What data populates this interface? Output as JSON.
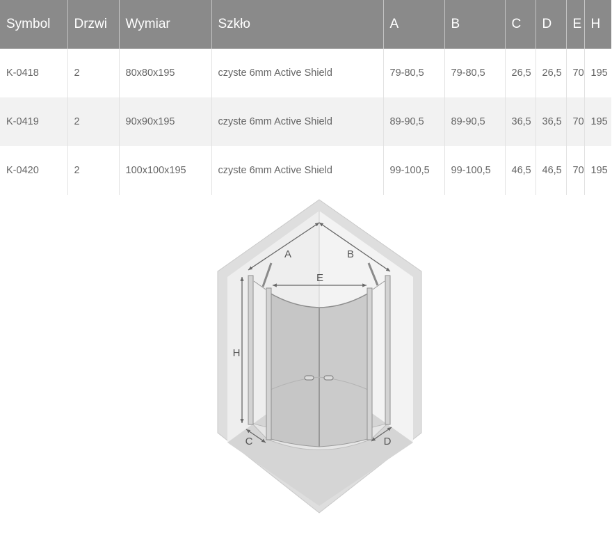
{
  "table": {
    "headers": [
      "Symbol",
      "Drzwi",
      "Wymiar",
      "Szkło",
      "A",
      "B",
      "C",
      "D",
      "E",
      "H"
    ],
    "rows": [
      [
        "K-0418",
        "2",
        "80x80x195",
        "czyste 6mm Active Shield",
        "79-80,5",
        "79-80,5",
        "26,5",
        "26,5",
        "70",
        "195"
      ],
      [
        "K-0419",
        "2",
        "90x90x195",
        "czyste 6mm Active Shield",
        "89-90,5",
        "89-90,5",
        "36,5",
        "36,5",
        "70",
        "195"
      ],
      [
        "K-0420",
        "2",
        "100x100x195",
        "czyste 6mm Active Shield",
        "99-100,5",
        "99-100,5",
        "46,5",
        "46,5",
        "70",
        "195"
      ]
    ]
  },
  "diagram": {
    "labels": {
      "a": "A",
      "b": "B",
      "e": "E",
      "h": "H",
      "c": "C",
      "d": "D"
    }
  }
}
